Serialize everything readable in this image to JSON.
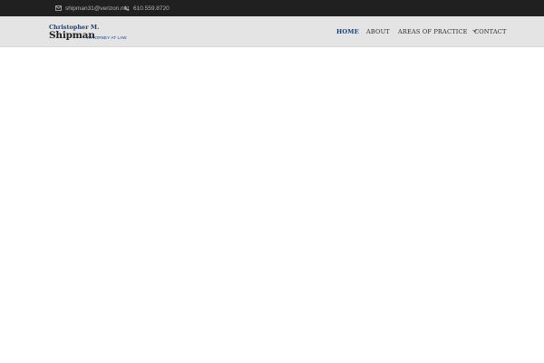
{
  "topbar": {
    "email": "shipman31@verizon.net",
    "phone": "610.559.8720"
  },
  "logo": {
    "first_line": "Christopher M.",
    "last_name": "Shipman",
    "tagline": "ATTORNEY AT LAW"
  },
  "nav": {
    "items": [
      {
        "label": "HOME",
        "active": true
      },
      {
        "label": "ABOUT",
        "active": false
      },
      {
        "label": "AREAS OF PRACTICE",
        "active": false,
        "has_dropdown": true
      },
      {
        "label": "CONTACT",
        "active": false
      }
    ]
  },
  "colors": {
    "topbar_bg": "#202020",
    "header_bg": "#e4e4e4",
    "brand": "#1f3f6e"
  },
  "icons": {
    "email": "envelope-icon",
    "phone": "phone-icon",
    "dropdown": "chevron-down-icon"
  }
}
